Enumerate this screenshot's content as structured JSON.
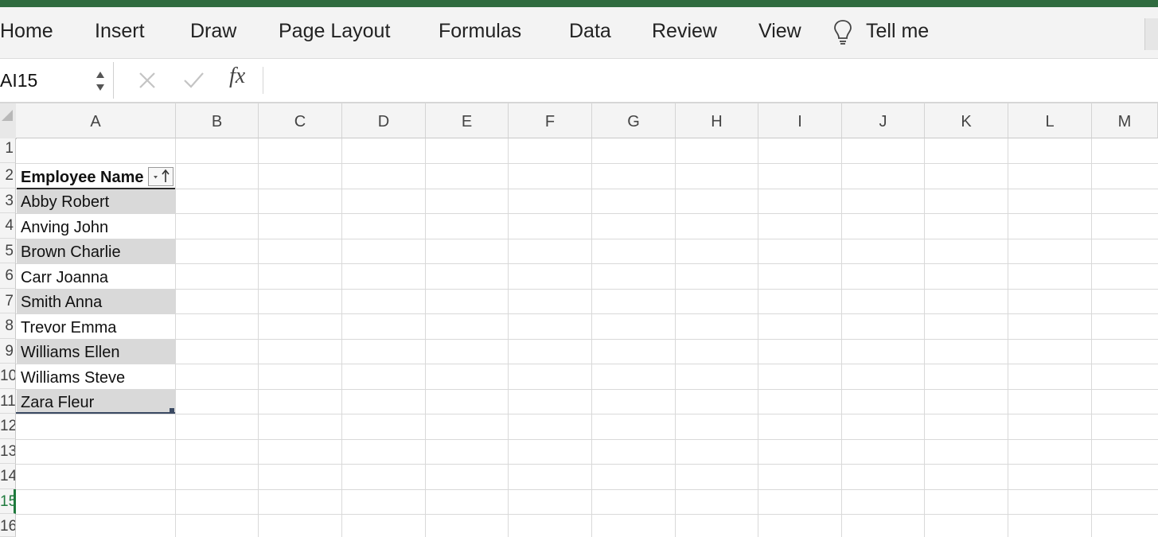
{
  "ribbon": {
    "tabs": [
      "Home",
      "Insert",
      "Draw",
      "Page Layout",
      "Formulas",
      "Data",
      "Review",
      "View"
    ],
    "tell_me": "Tell me",
    "bulb_icon": "lightbulb-icon"
  },
  "formula_bar": {
    "name_box": "AI15",
    "formula_value": "",
    "fx_label": "fx"
  },
  "grid": {
    "columns": [
      "A",
      "B",
      "C",
      "D",
      "E",
      "F",
      "G",
      "H",
      "I",
      "J",
      "K",
      "L",
      "M"
    ],
    "rows": [
      "1",
      "2",
      "3",
      "4",
      "5",
      "6",
      "7",
      "8",
      "9",
      "10",
      "11",
      "12",
      "13",
      "14",
      "15",
      "16"
    ],
    "active_row": "15"
  },
  "table": {
    "header": "Employee Name",
    "names": [
      "Abby Robert",
      "Anving John",
      "Brown Charlie",
      "Carr Joanna",
      "Smith Anna",
      "Trevor Emma",
      "Williams Ellen",
      "Williams Steve",
      "Zara Fleur"
    ],
    "band_color": "#d9d9d9"
  },
  "colors": {
    "accent": "#2f6b3f",
    "active_row": "#1f7a3d"
  }
}
